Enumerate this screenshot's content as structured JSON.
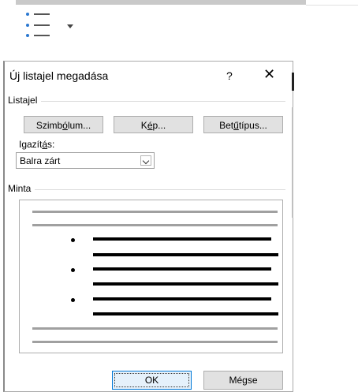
{
  "ribbon": {
    "bullets_button_icon": "bullet-list-icon",
    "dropdown_icon": "chevron-down-icon"
  },
  "dialog": {
    "title": "Új listajel megadása",
    "help": "?",
    "close": "✕",
    "bullet_group_label": "Listajel",
    "buttons": [
      {
        "pre": "Szimb",
        "u": "ó",
        "post": "lum..."
      },
      {
        "pre": "K",
        "u": "é",
        "post": "p..."
      },
      {
        "pre": "Bet",
        "u": "ű",
        "post": "típus..."
      }
    ],
    "alignment": {
      "label_pre": "Igazít",
      "label_u": "á",
      "label_post": "s:",
      "value": "Balra zárt"
    },
    "preview_label": "Minta",
    "ok": "OK",
    "cancel": "Mégse"
  },
  "colors": {
    "ok_border": "#0078d7",
    "bullet_blue": "#2b78d0"
  }
}
